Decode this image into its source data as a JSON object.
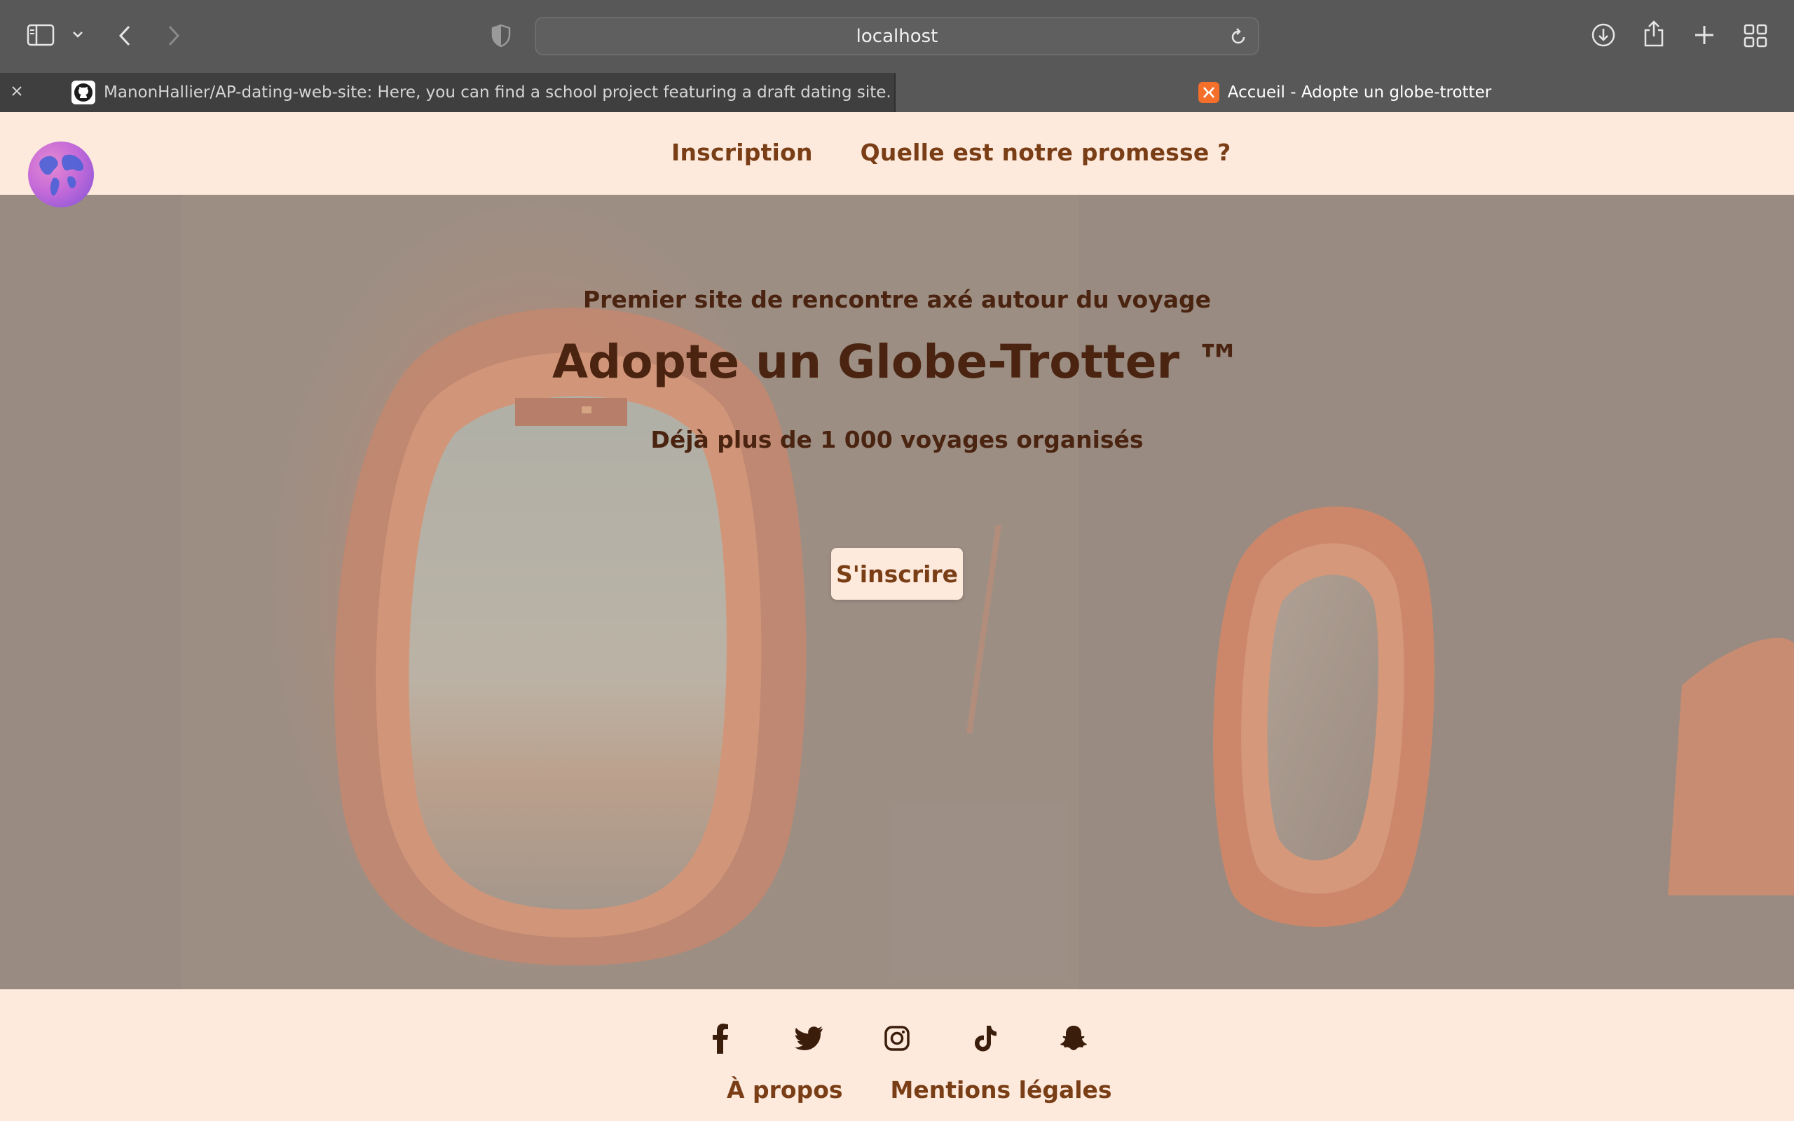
{
  "browser": {
    "url": "localhost",
    "tabs": [
      {
        "title": "ManonHallier/AP-dating-web-site: Here, you can find a school project featuring a draft dating site.",
        "favicon": "github-icon",
        "active": false
      },
      {
        "title": "Accueil - Adopte un globe-trotter",
        "favicon": "xampp-icon",
        "active": true
      }
    ]
  },
  "nav": {
    "logo": "globe-logo",
    "links": [
      "Inscription",
      "Quelle est notre promesse ?"
    ]
  },
  "hero": {
    "subtitle": "Premier site de rencontre axé autour du voyage",
    "title": "Adopte un Globe-Trotter ™",
    "stat": "Déjà plus de 1 000 voyages organisés",
    "cta": "S'inscrire"
  },
  "footer": {
    "socials": [
      "facebook-icon",
      "twitter-icon",
      "instagram-icon",
      "tiktok-icon",
      "snapchat-icon"
    ],
    "links": [
      "À propos",
      "Mentions légales"
    ]
  },
  "colors": {
    "accent": "#7a3e16",
    "dark_text": "#4a2410",
    "page_bg": "#fdeadd"
  }
}
